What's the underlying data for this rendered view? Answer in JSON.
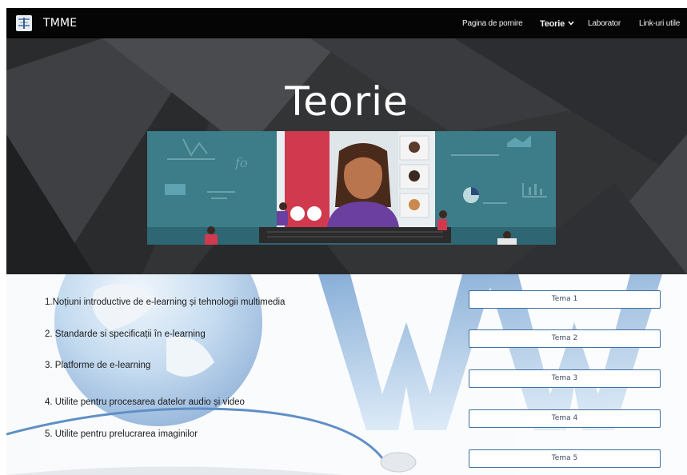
{
  "site": {
    "name": "TMME"
  },
  "nav": {
    "home": "Pagina de pornire",
    "teorie": "Teorie",
    "lab": "Laborator",
    "links": "Link-uri utile"
  },
  "hero": {
    "title": "Teorie"
  },
  "topics": [
    "1.Noțiuni introductive de e-learning și tehnologii multimedia",
    "2. Standarde si specificații în e-learning",
    "3. Platforme de e-learning",
    "4. Utilite pentru procesarea datelor audio și video",
    "5. Utilite pentru prelucrarea imaginilor"
  ],
  "buttons": [
    "Tema 1",
    "Tema 2",
    "Tema 3",
    "Tema 4",
    "Tema 5"
  ],
  "colors": {
    "navbar": "#050505",
    "button_border": "#3e6fa0",
    "banner_teal": "#3d7c89"
  }
}
